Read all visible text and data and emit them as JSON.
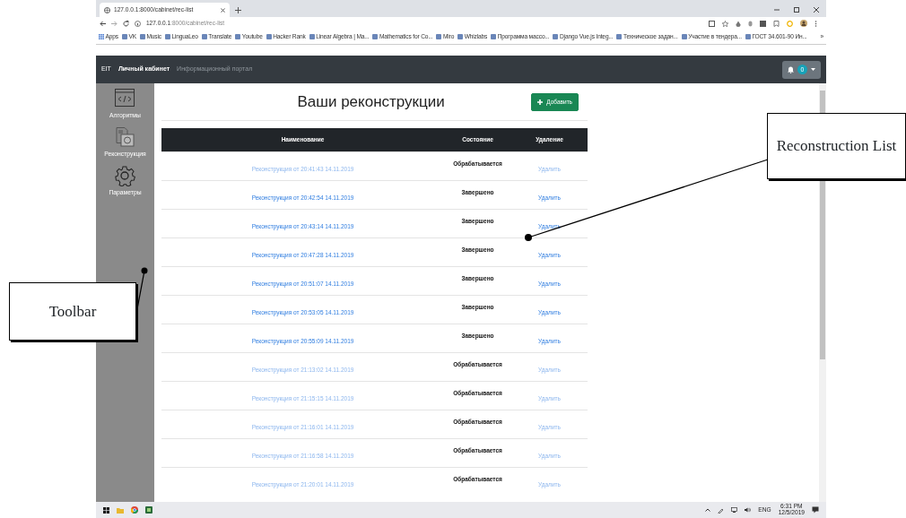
{
  "browser": {
    "tab_title": "127.0.0.1:8000/cabinet/rec-list",
    "url_host": "127.0.0.1",
    "url_path": ":8000/cabinet/rec-list",
    "bookmarks": [
      "Apps",
      "VK",
      "Music",
      "LinguaLeo",
      "Translate",
      "Youtube",
      "Hacker Rank",
      "Linear Algebra | Ma...",
      "Mathematics for Co...",
      "Miro",
      "Whizlabs",
      "Программа массо...",
      "Django Vue.js Integ...",
      "Техническое задан...",
      "Участие в тендера...",
      "ГОСТ 34.601-90 Ин..."
    ],
    "more": "»"
  },
  "navbar": {
    "brand": "EIT",
    "links": [
      {
        "label": "Личный кабинет",
        "selected": true
      },
      {
        "label": "Информационный портал",
        "selected": false
      }
    ],
    "badge": "0"
  },
  "sidebar": {
    "items": [
      {
        "label": "Алгоритмы",
        "kind": "code"
      },
      {
        "label": "Реконструкция",
        "kind": "document"
      },
      {
        "label": "Параметры",
        "kind": "gear"
      }
    ]
  },
  "page": {
    "title": "Ваши реконструкции",
    "add_button": "Добавить",
    "columns": [
      "Наименование",
      "Состояние",
      "Удаление"
    ],
    "rows": [
      {
        "name": "Реконструкция от 20:41:43 14.11.2019",
        "status": "Обрабатывается",
        "action": "Удалить",
        "dimmed": true
      },
      {
        "name": "Реконструкция от 20:42:54 14.11.2019",
        "status": "Завершено",
        "action": "Удалить",
        "dimmed": false
      },
      {
        "name": "Реконструкция от 20:43:14 14.11.2019",
        "status": "Завершено",
        "action": "Удалить",
        "dimmed": false
      },
      {
        "name": "Реконструкция от 20:47:28 14.11.2019",
        "status": "Завершено",
        "action": "Удалить",
        "dimmed": false
      },
      {
        "name": "Реконструкция от 20:51:07 14.11.2019",
        "status": "Завершено",
        "action": "Удалить",
        "dimmed": false
      },
      {
        "name": "Реконструкция от 20:53:05 14.11.2019",
        "status": "Завершено",
        "action": "Удалить",
        "dimmed": false
      },
      {
        "name": "Реконструкция от 20:55:09 14.11.2019",
        "status": "Завершено",
        "action": "Удалить",
        "dimmed": false
      },
      {
        "name": "Реконструкция от 21:13:02 14.11.2019",
        "status": "Обрабатывается",
        "action": "Удалить",
        "dimmed": true
      },
      {
        "name": "Реконструкция от 21:15:15 14.11.2019",
        "status": "Обрабатывается",
        "action": "Удалить",
        "dimmed": true
      },
      {
        "name": "Реконструкция от 21:16:01 14.11.2019",
        "status": "Обрабатывается",
        "action": "Удалить",
        "dimmed": true
      },
      {
        "name": "Реконструкция от 21:16:58 14.11.2019",
        "status": "Обрабатывается",
        "action": "Удалить",
        "dimmed": true
      },
      {
        "name": "Реконструкция от 21:20:01 14.11.2019",
        "status": "Обрабатывается",
        "action": "Удалить",
        "dimmed": true
      }
    ]
  },
  "taskbar": {
    "language": "ENG",
    "time": "6:31 PM",
    "date": "12/5/2019"
  },
  "annotations": [
    {
      "text": "Toolbar"
    },
    {
      "text": "Reconstruction List"
    }
  ]
}
